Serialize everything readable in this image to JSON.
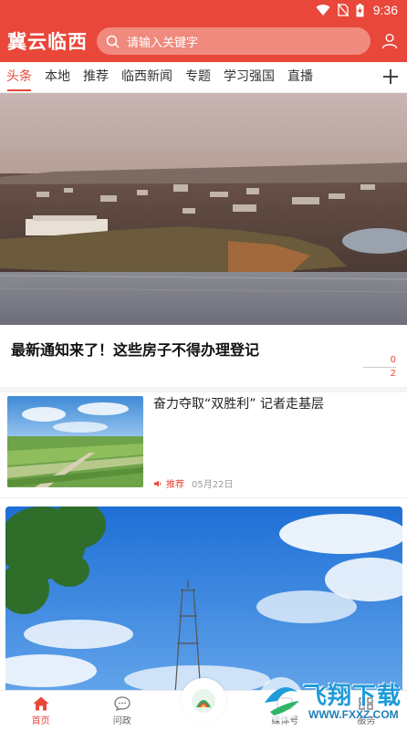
{
  "status_bar": {
    "time": "9:36",
    "icons": [
      "wifi-icon",
      "no-sim-icon",
      "battery-charging-icon"
    ]
  },
  "header": {
    "app_title": "冀云临西",
    "search_placeholder": "请输入关键字"
  },
  "tabs": [
    {
      "label": "头条",
      "active": true
    },
    {
      "label": "本地"
    },
    {
      "label": "推荐"
    },
    {
      "label": "临西新闻"
    },
    {
      "label": "专题"
    },
    {
      "label": "学习强国"
    },
    {
      "label": "直播"
    }
  ],
  "hero": {
    "title": "最新通知来了！这些房子不得办理登记",
    "count_top": "0",
    "count_bottom": "2"
  },
  "news": [
    {
      "title": "奋力夺取“双胜利” 记者走基层",
      "tag": "推荐",
      "date": "05月22日"
    }
  ],
  "bottom_nav": [
    {
      "label": "首页",
      "icon": "home-icon",
      "active": true
    },
    {
      "label": "问政",
      "icon": "chat-icon"
    },
    {
      "label": "",
      "icon": "center-logo-icon"
    },
    {
      "label": "媒体号",
      "icon": "media-icon"
    },
    {
      "label": "服务",
      "icon": "service-icon"
    }
  ],
  "watermark": {
    "text": "飞翔下载",
    "url": "WWW.FXXZ.COM"
  },
  "colors": {
    "brand": "#e8473a",
    "search_bg": "#f08a7e"
  }
}
